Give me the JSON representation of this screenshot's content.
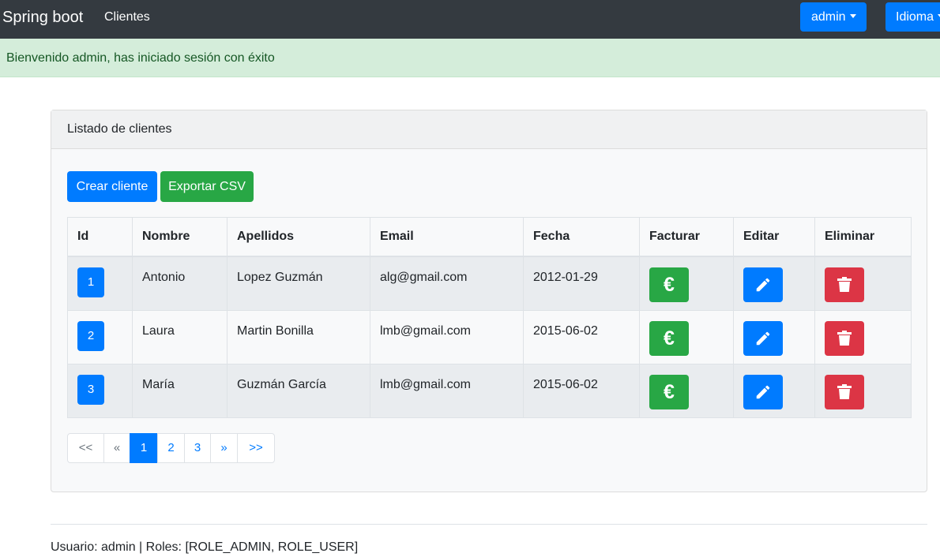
{
  "navbar": {
    "brand": "Spring boot",
    "links": [
      "Clientes"
    ],
    "user_menu_label": "admin",
    "language_menu_label": "Idioma"
  },
  "alert": {
    "message": "Bienvenido admin, has iniciado sesión con éxito"
  },
  "card": {
    "title": "Listado de clientes",
    "create_button": "Crear cliente",
    "export_button": "Exportar CSV"
  },
  "table": {
    "headers": [
      "Id",
      "Nombre",
      "Apellidos",
      "Email",
      "Fecha",
      "Facturar",
      "Editar",
      "Eliminar"
    ],
    "rows": [
      {
        "id": "1",
        "nombre": "Antonio",
        "apellidos": "Lopez Guzmán",
        "email": "alg@gmail.com",
        "fecha": "2012-01-29"
      },
      {
        "id": "2",
        "nombre": "Laura",
        "apellidos": "Martin Bonilla",
        "email": "lmb@gmail.com",
        "fecha": "2015-06-02"
      },
      {
        "id": "3",
        "nombre": "María",
        "apellidos": "Guzmán García",
        "email": "lmb@gmail.com",
        "fecha": "2015-06-02"
      }
    ],
    "invoice_icon": "euro-icon",
    "edit_icon": "pencil-icon",
    "delete_icon": "trash-icon"
  },
  "pagination": {
    "items": [
      "<<",
      "«",
      "1",
      "2",
      "3",
      "»",
      ">>"
    ],
    "active_page": "1"
  },
  "footer": {
    "text": "Usuario: admin | Roles: [ROLE_ADMIN, ROLE_USER]"
  },
  "colors": {
    "navbar": "#343a40",
    "primary": "#007bff",
    "success": "#28a745",
    "danger": "#dc3545",
    "alert_bg": "#d4edda",
    "alert_text": "#155724"
  }
}
